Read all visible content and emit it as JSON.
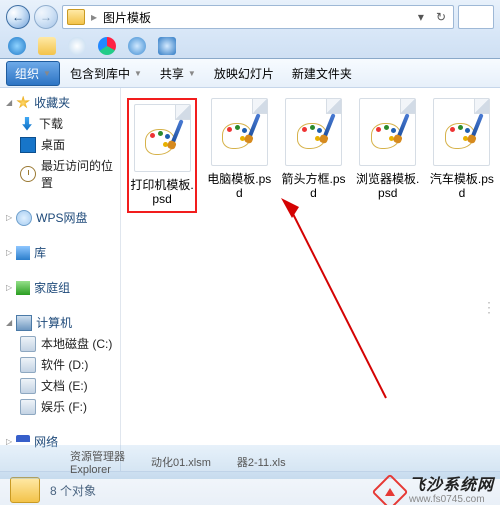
{
  "header": {
    "folder_label": "图片模板"
  },
  "toolbar": {
    "organize": "组织",
    "include": "包含到库中",
    "share": "共享",
    "slideshow": "放映幻灯片",
    "newfolder": "新建文件夹"
  },
  "sidebar": {
    "fav": {
      "title": "收藏夹",
      "items": [
        {
          "label": "下载"
        },
        {
          "label": "桌面"
        },
        {
          "label": "最近访问的位置"
        }
      ]
    },
    "wps": {
      "title": "WPS网盘"
    },
    "lib": {
      "title": "库"
    },
    "home": {
      "title": "家庭组"
    },
    "comp": {
      "title": "计算机",
      "items": [
        {
          "label": "本地磁盘 (C:)"
        },
        {
          "label": "软件 (D:)"
        },
        {
          "label": "文档 (E:)"
        },
        {
          "label": "娱乐 (F:)"
        }
      ]
    },
    "net": {
      "title": "网络"
    }
  },
  "files": [
    {
      "name": "打印机模板.psd",
      "highlight": true
    },
    {
      "name": "电脑模板.psd"
    },
    {
      "name": "箭头方框.psd"
    },
    {
      "name": "浏览器模板.psd"
    },
    {
      "name": "汽车模板.psd"
    }
  ],
  "status": {
    "count_label": "8 个对象"
  },
  "osbar": {
    "items": [
      "资源管理器\nExplorer",
      "动化01.xlsm",
      "器2-11.xls"
    ]
  },
  "brand": {
    "name": "飞沙系统网",
    "url": "www.fs0745.com"
  }
}
